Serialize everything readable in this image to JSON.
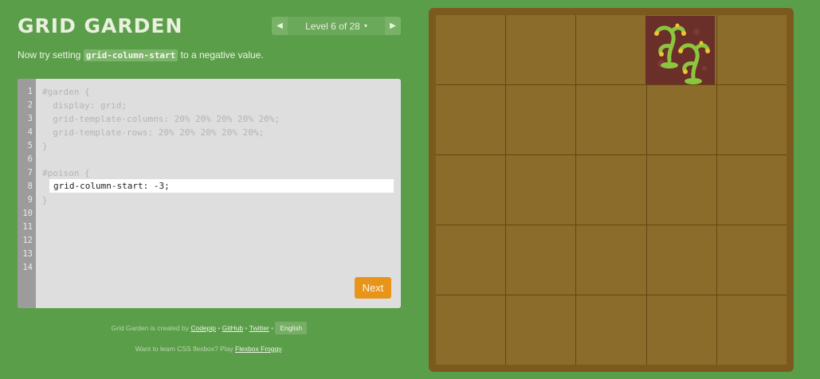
{
  "header": {
    "title": "GRID GARDEN",
    "level_label": "Level 6 of 28",
    "prev_icon": "◀",
    "next_icon": "▶",
    "dropdown_icon": "▾"
  },
  "instructions": {
    "before": "Now try setting ",
    "code": "grid-column-start",
    "after": " to a negative value."
  },
  "editor": {
    "line_numbers": [
      "1",
      "2",
      "3",
      "4",
      "5",
      "6",
      "7",
      "8",
      "9",
      "10",
      "11",
      "12",
      "13",
      "14"
    ],
    "lines": [
      "#garden {",
      "  display: grid;",
      "  grid-template-columns: 20% 20% 20% 20% 20%;",
      "  grid-template-rows: 20% 20% 20% 20% 20%;",
      "}",
      "",
      "#poison {",
      "",
      "}"
    ],
    "input_value": "grid-column-start: -3;",
    "next_label": "Next"
  },
  "footer": {
    "line1_prefix": "Grid Garden is created by ",
    "codepip": "Codepip",
    "sep1": " • ",
    "github": "GitHub",
    "sep2": " • ",
    "twitter": "Twitter",
    "sep3": " • ",
    "language": "English",
    "line2_prefix": "Want to learn CSS flexbox? Play ",
    "flexbox_froggy": "Flexbox Froggy",
    "line2_suffix": "."
  },
  "garden": {
    "columns": 5,
    "rows": 5,
    "poison_column_start": -3,
    "colors": {
      "soil": "#8b6c2b",
      "border": "#7c5a1e",
      "poison": "#6b2f2a",
      "weed": "#8cc63f"
    }
  }
}
